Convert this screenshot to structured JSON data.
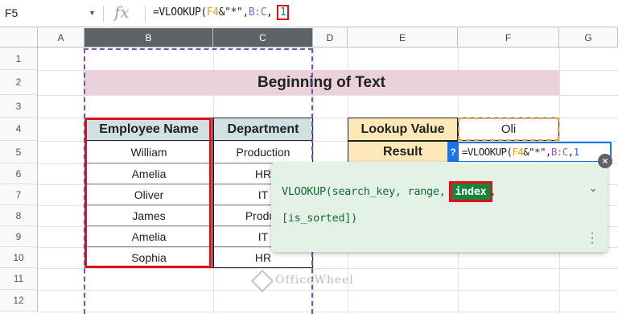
{
  "formula_bar": {
    "cell_ref": "F5",
    "fx": "fx",
    "formula_parts": {
      "p1": "=VLOOKUP(",
      "p2": "F4",
      "p3": "&\"*\",",
      "p4": "B:C",
      "p5": ",",
      "p6": "1"
    }
  },
  "columns": [
    "A",
    "B",
    "C",
    "D",
    "E",
    "F",
    "G"
  ],
  "rows": [
    "1",
    "2",
    "3",
    "4",
    "5",
    "6",
    "7",
    "8",
    "9",
    "10",
    "11",
    "12"
  ],
  "title": "Beginning of Text",
  "table": {
    "headers": [
      "Employee Name",
      "Department"
    ],
    "rows": [
      [
        "William",
        "Production"
      ],
      [
        "Amelia",
        "HR"
      ],
      [
        "Oliver",
        "IT"
      ],
      [
        "James",
        "Produc"
      ],
      [
        "Amelia",
        "IT"
      ],
      [
        "Sophia",
        "HR"
      ]
    ]
  },
  "lookup": {
    "label_value": "Lookup Value",
    "value": "Oli",
    "label_result": "Result"
  },
  "editing": {
    "qmark": "?",
    "p1": "=VLOOKUP(",
    "p2": "F4",
    "p3": "&\"*\",",
    "p4": "B:C",
    "p5": ",",
    "p6": "1"
  },
  "help": {
    "sig1": "VLOOKUP(search_key, range, ",
    "sig_index": "index",
    "sig2": ",",
    "sig3": "[is_sorted])"
  },
  "watermark": "OfficeWheel",
  "colors": {
    "title_bg": "#ead1dc",
    "header_bg": "#d0e0e3",
    "lookup_bg": "#fde8b8",
    "highlight_red": "#e0101a",
    "edit_blue": "#1a73e8"
  }
}
